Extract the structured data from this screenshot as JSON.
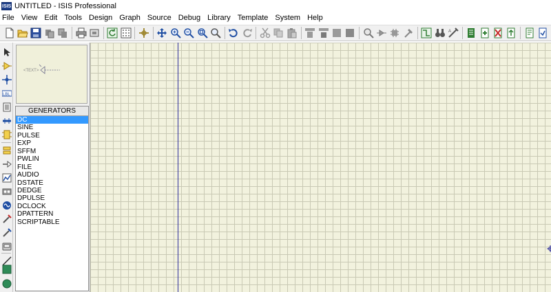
{
  "window": {
    "app_icon_text": "ISIS",
    "title": "UNTITLED - ISIS Professional"
  },
  "menubar": {
    "items": [
      "File",
      "View",
      "Edit",
      "Tools",
      "Design",
      "Graph",
      "Source",
      "Debug",
      "Library",
      "Template",
      "System",
      "Help"
    ]
  },
  "preview": {
    "text_label": "<TEXT>"
  },
  "generators": {
    "header": "GENERATORS",
    "selected": "DC",
    "items": [
      "DC",
      "SINE",
      "PULSE",
      "EXP",
      "SFFM",
      "PWLIN",
      "FILE",
      "AUDIO",
      "DSTATE",
      "DEDGE",
      "DPULSE",
      "DCLOCK",
      "DPATTERN",
      "SCRIPTABLE"
    ]
  },
  "left_toolbar": {
    "mode_label": "LBL"
  },
  "colors": {
    "canvas_background": "#f2f2de",
    "grid_line": "#c9c9b4",
    "selection": "#3399ff",
    "origin_line": "#2b2b9a"
  }
}
